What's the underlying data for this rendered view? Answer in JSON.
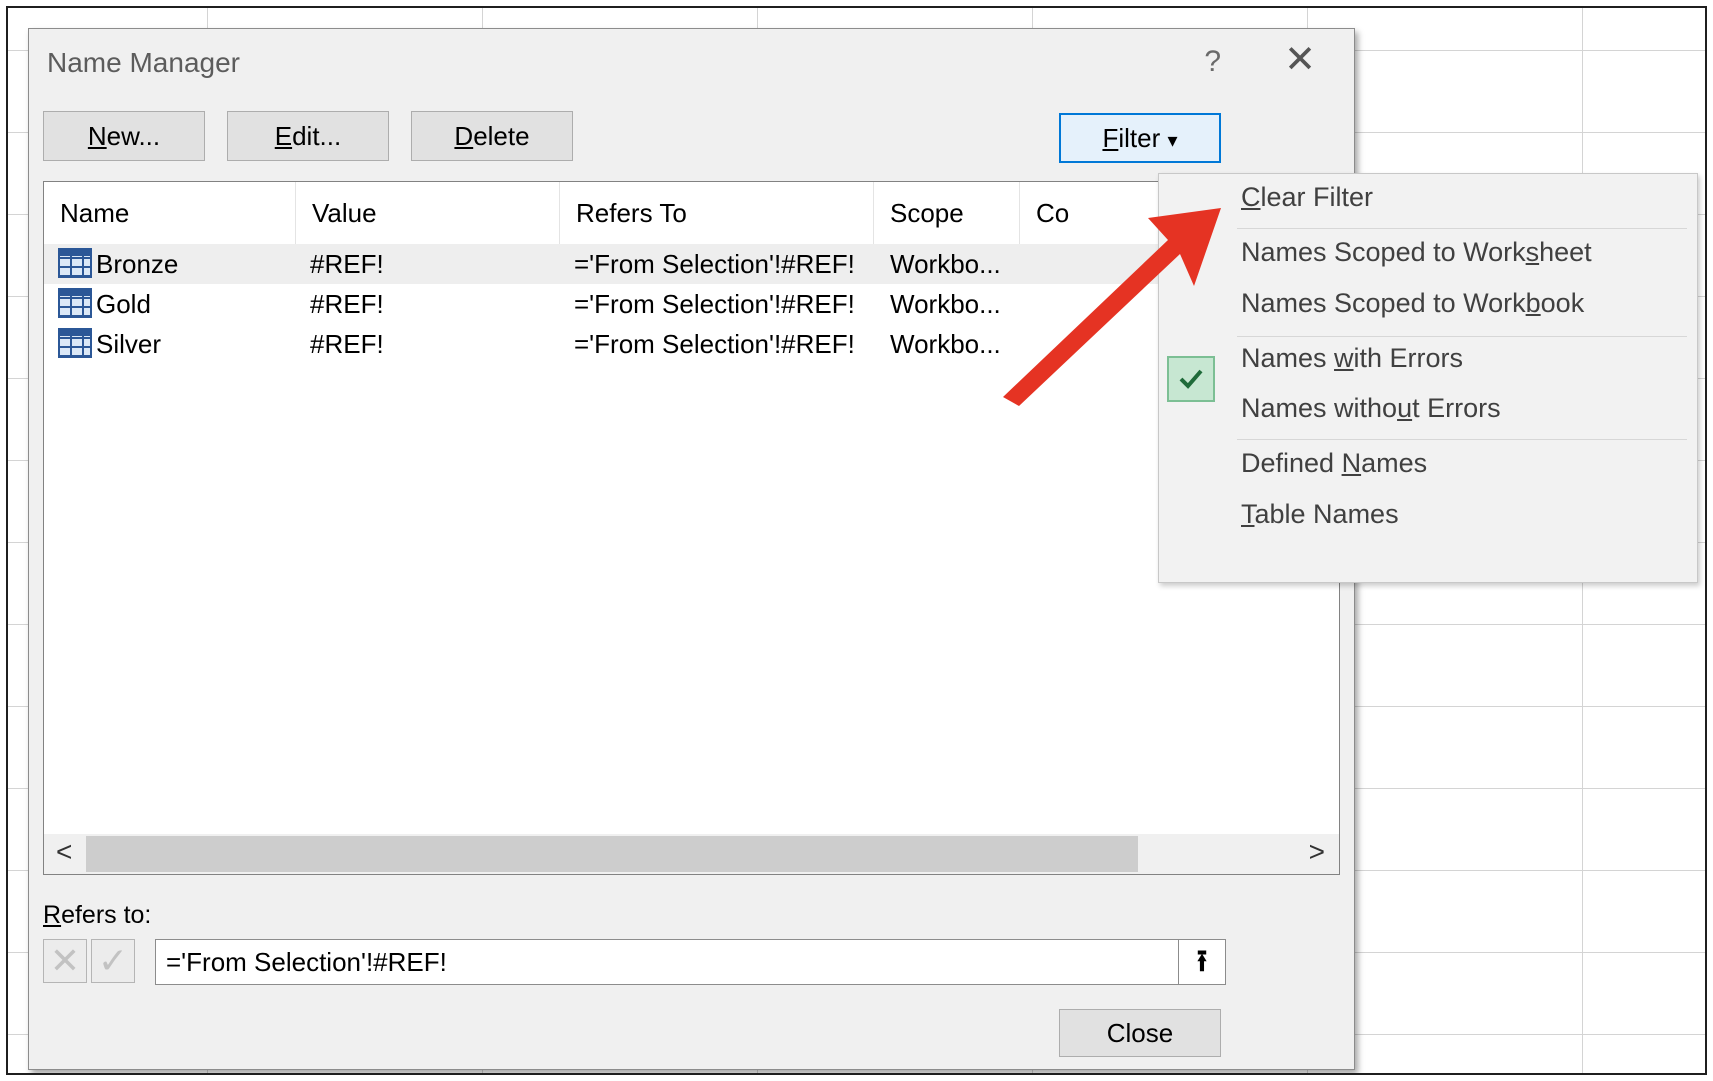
{
  "dialog": {
    "title": "Name Manager",
    "help": "?",
    "close_glyph": "✕"
  },
  "toolbar": {
    "new": {
      "u": "N",
      "rest": "ew..."
    },
    "edit": {
      "u": "E",
      "rest": "dit..."
    },
    "delete": {
      "u": "D",
      "rest": "elete"
    },
    "filter": {
      "u": "F",
      "rest": "ilter",
      "caret": "▾"
    }
  },
  "list": {
    "columns": {
      "name": "Name",
      "value": "Value",
      "refers_to": "Refers To",
      "scope": "Scope",
      "comment": "Co"
    },
    "rows": [
      {
        "name": "Bronze",
        "value": "#REF!",
        "refers_to": "='From Selection'!#REF!",
        "scope": "Workbo..."
      },
      {
        "name": "Gold",
        "value": "#REF!",
        "refers_to": "='From Selection'!#REF!",
        "scope": "Workbo..."
      },
      {
        "name": "Silver",
        "value": "#REF!",
        "refers_to": "='From Selection'!#REF!",
        "scope": "Workbo..."
      }
    ],
    "scroll_left": "<",
    "scroll_right": ">"
  },
  "refers": {
    "label_u": "R",
    "label_rest": "efers to:",
    "value": "='From Selection'!#REF!",
    "cancel_glyph": "✕",
    "confirm_glyph": "✓",
    "collapse_glyph": "⭱"
  },
  "close_button": "Close",
  "filter_menu": {
    "clear_filter": {
      "u": "C",
      "rest": "lear Filter"
    },
    "scoped_worksheet": {
      "pre": "Names Scoped to Work",
      "u": "s",
      "post": "heet"
    },
    "scoped_workbook": {
      "pre": "Names Scoped to Work",
      "u": "b",
      "post": "ook"
    },
    "with_errors": {
      "pre": "Names ",
      "u": "w",
      "post": "ith Errors",
      "checked": true
    },
    "without_errors": {
      "pre": "Names witho",
      "u": "u",
      "post": "t Errors"
    },
    "defined_names": {
      "pre": "Defined ",
      "u": "N",
      "post": "ames"
    },
    "table_names": {
      "u": "T",
      "rest": "able Names"
    }
  },
  "colors": {
    "annotation_arrow": "#e53323",
    "table_icon": "#2b5797",
    "filter_border": "#0078d7",
    "check_bg": "#c7e7d2"
  }
}
